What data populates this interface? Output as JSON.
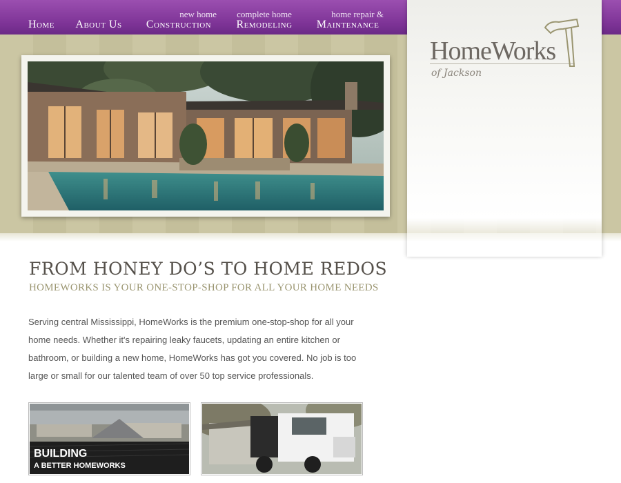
{
  "nav": {
    "home": "Home",
    "about": "About Us",
    "construction_small": "new home",
    "construction": "Construction",
    "remodeling_small": "complete home",
    "remodeling": "Remodeling",
    "maintenance_small": "home repair &",
    "maintenance": "Maintenance"
  },
  "logo": {
    "name": "HomeWorks",
    "tagline": "of Jackson"
  },
  "main": {
    "headline": "FROM HONEY DO’S TO HOME REDOS",
    "subheadline": "HOMEWORKS IS YOUR ONE-STOP-SHOP FOR ALL YOUR HOME NEEDS",
    "intro": "Serving central Mississippi, HomeWorks is the premium one-stop-shop for all your home needs. Whether it's repairing leaky faucets, updating an entire kitchen or bathroom, or building a new home, HomeWorks has got you covered. No job is too large or small for our talented team of over 50 top service professionals."
  },
  "features": [
    {
      "title": "BUILDING",
      "subtitle": "A BETTER HOMEWORKS"
    }
  ],
  "colors": {
    "nav_purple": "#7d3396",
    "banner_khaki": "#c8c3a0",
    "heading_gray": "#55504a",
    "subhead_olive": "#9a9570"
  }
}
